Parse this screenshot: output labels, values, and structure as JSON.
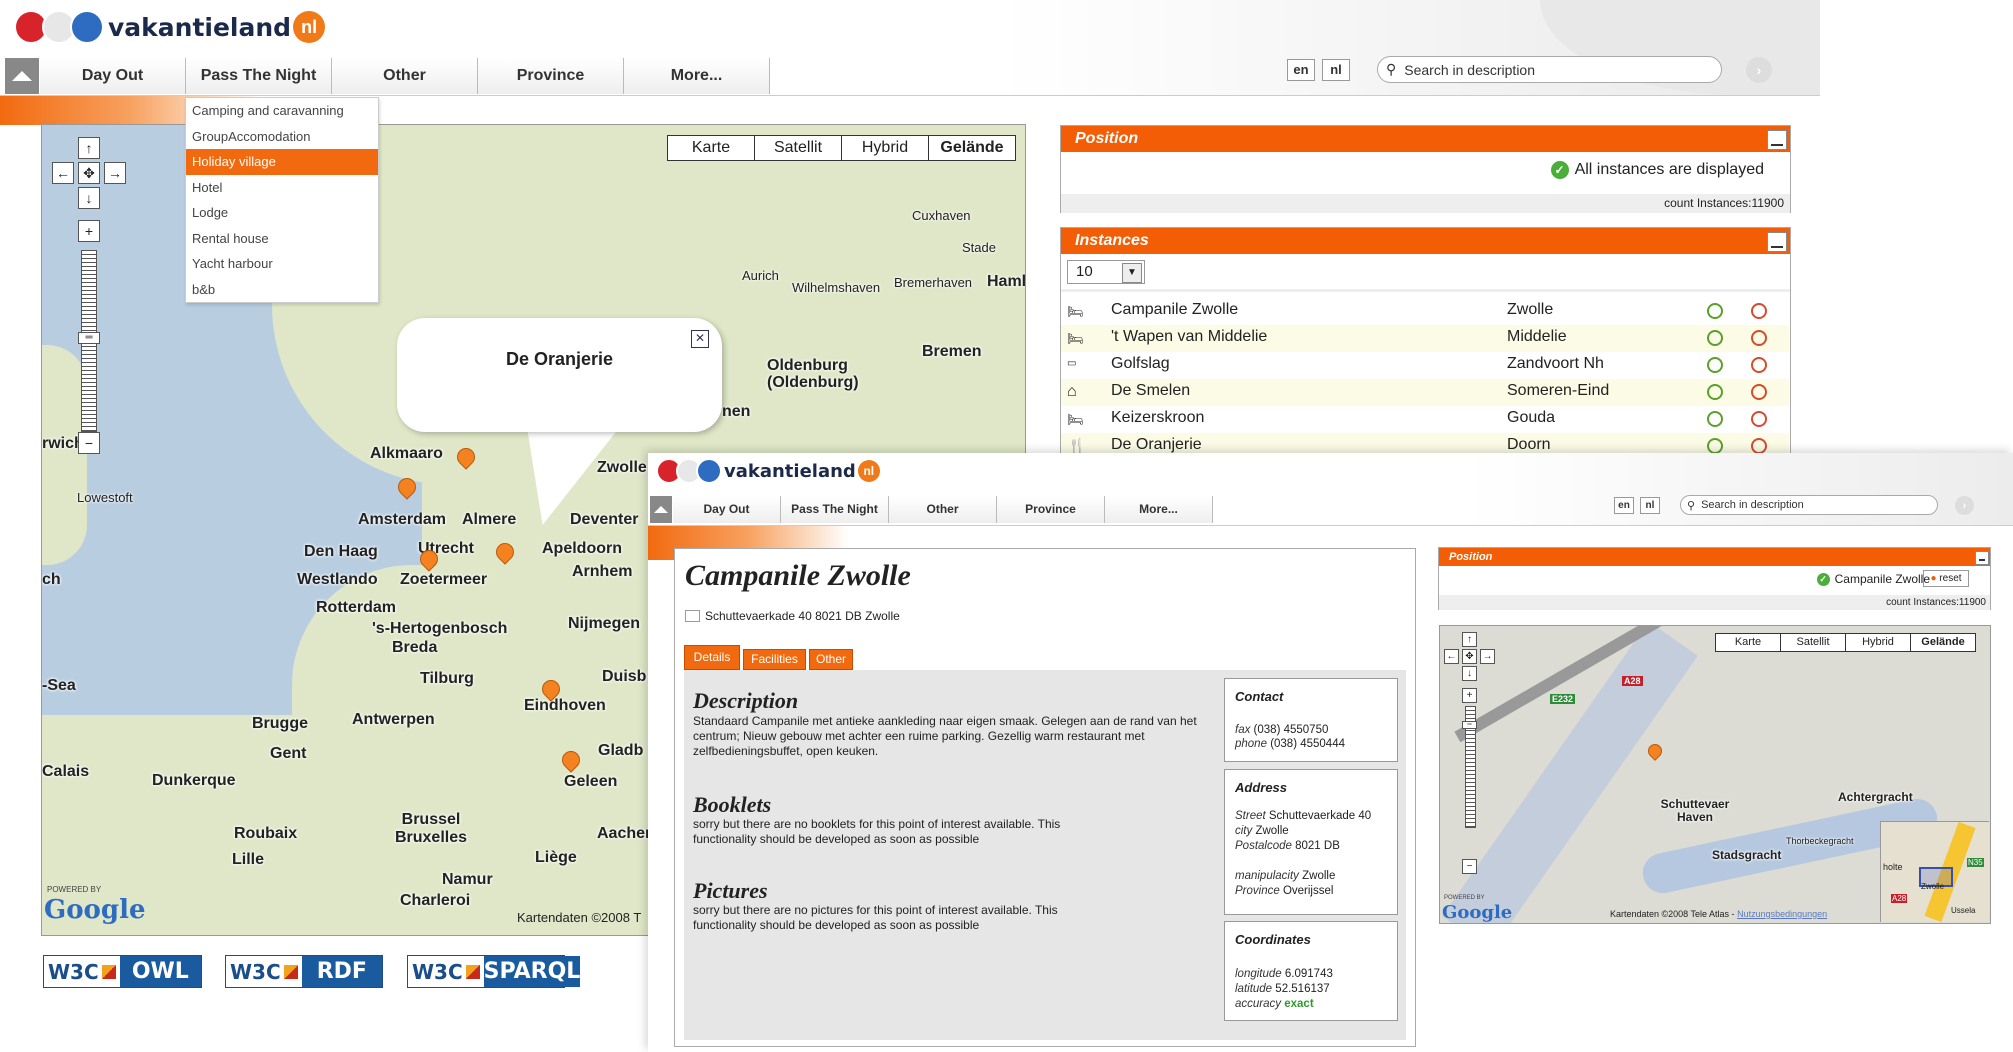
{
  "window1": {
    "logo": {
      "word": "vakantieland",
      "suffix": "nl"
    },
    "nav": [
      "Day Out",
      "Pass The Night",
      "Other",
      "Province",
      "More..."
    ],
    "lang": [
      "en",
      "nl"
    ],
    "search_placeholder": "Search in description",
    "dropdown": [
      "Camping and caravanning",
      "GroupAccomodation",
      "Holiday village",
      "Hotel",
      "Lodge",
      "Rental house",
      "Yacht harbour",
      "b&b"
    ],
    "dropdown_active_index": 2,
    "map": {
      "types": [
        "Karte",
        "Satellit",
        "Hybrid",
        "Gelände"
      ],
      "balloon_title": "De Oranjerie",
      "labels": [
        "Cuxhaven",
        "Stade",
        "Aurich",
        "Wilhelmshaven",
        "Bremerhaven",
        "Haml",
        "Bremen",
        "Oldenburg (Oldenburg)",
        "nen",
        "rwich",
        "Lowestoft",
        "Alkmaaro",
        "Zwolle",
        "Amsterdam",
        "Almere",
        "Deventer",
        "Den Haag",
        "Utrecht",
        "Apeldoorn",
        "Westlando",
        "Zoetermeer",
        "Arnhem",
        "ch",
        "Rotterdam",
        "'s-Hertogenbosch",
        "Nijmegen",
        "Breda",
        "Tilburg",
        "Duisb",
        "-Sea",
        "Eindhoven",
        "Brugge",
        "Antwerpen",
        "Gent",
        "Gladb",
        "Calais",
        "Dunkerque",
        "Geleen",
        "Brussel Bruxelles",
        "Aacher",
        "Roubaix",
        "Lille",
        "Liège",
        "Namur",
        "Charleroi"
      ],
      "powered_by": "POWERED BY",
      "google": "Google",
      "copyright": "Kartendaten ©2008 T"
    },
    "position_panel": {
      "title": "Position",
      "status": "All instances are displayed",
      "count": "count Instances:11900"
    },
    "instances_panel": {
      "title": "Instances",
      "page_size": "10",
      "rows": [
        {
          "name": "Campanile Zwolle",
          "city": "Zwolle"
        },
        {
          "name": "'t Wapen van Middelie",
          "city": "Middelie"
        },
        {
          "name": "Golfslag",
          "city": "Zandvoort Nh"
        },
        {
          "name": "De Smelen",
          "city": "Someren-Eind"
        },
        {
          "name": "Keizerskroon",
          "city": "Gouda"
        },
        {
          "name": "De Oranjerie",
          "city": "Doorn"
        }
      ]
    },
    "badges": [
      {
        "left": "W3C",
        "right": "OWL"
      },
      {
        "left": "W3C",
        "right": "RDF"
      },
      {
        "left": "W3C",
        "right": "SPARQL"
      }
    ]
  },
  "window2": {
    "logo": {
      "word": "vakantieland",
      "suffix": "nl"
    },
    "nav": [
      "Day Out",
      "Pass The Night",
      "Other",
      "Province",
      "More..."
    ],
    "lang": [
      "en",
      "nl"
    ],
    "search_placeholder": "Search in description",
    "title": "Campanile Zwolle",
    "address_line": "Schuttevaerkade 40 8021 DB Zwolle",
    "tabs": [
      "Details",
      "Facilities",
      "Other"
    ],
    "sections": [
      {
        "heading": "Description",
        "text": "Standaard Campanile met antieke aankleding naar eigen smaak. Gelegen aan de rand van het centrum; Nieuw gebouw met achter een ruime parking. Gezellig warm restaurant met zelfbedieningsbuffet, open keuken."
      },
      {
        "heading": "Booklets",
        "text": "sorry but there are no booklets for this point of interest available. This functionality should be developed as soon as possible"
      },
      {
        "heading": "Pictures",
        "text": "sorry but there are no pictures for this point of interest available. This functionality should be developed as soon as possible"
      }
    ],
    "contact": {
      "title": "Contact",
      "fax_label": "fax",
      "fax": "(038) 4550750",
      "phone_label": "phone",
      "phone": "(038) 4550444"
    },
    "address": {
      "title": "Address",
      "street_label": "Street",
      "street": "Schuttevaerkade 40",
      "city_label": "city",
      "city": "Zwolle",
      "postal_label": "Postalcode",
      "postal": "8021 DB",
      "mun_label": "manipulacity",
      "mun": "Zwolle",
      "prov_label": "Province",
      "prov": "Overijssel"
    },
    "coordinates": {
      "title": "Coordinates",
      "lon_label": "longitude",
      "lon": "6.091743",
      "lat_label": "latitude",
      "lat": "52.516137",
      "acc_label": "accuracy",
      "acc": "exact"
    },
    "position_panel": {
      "title": "Position",
      "status": "Campanile Zwolle",
      "reset": "reset",
      "count": "count Instances:11900"
    },
    "map": {
      "types": [
        "Karte",
        "Satellit",
        "Hybrid",
        "Gelände"
      ],
      "labels": [
        "Schuttevaer Haven",
        "Achtergracht",
        "Stadsgracht",
        "Thorbeckegracht",
        "A28",
        "E232",
        "N35"
      ],
      "powered_by": "POWERED BY",
      "google": "Google",
      "copyright": "Kartendaten ©2008 Tele Atlas -",
      "terms": "Nutzungsbedingungen",
      "inset": [
        "holte",
        "A28",
        "Zwolle",
        "Ussela"
      ]
    }
  },
  "colors": {
    "orange": "#f25d05",
    "navy": "#1b2a4a",
    "w3c_blue": "#1a5ba0",
    "green": "#4cae3a"
  }
}
